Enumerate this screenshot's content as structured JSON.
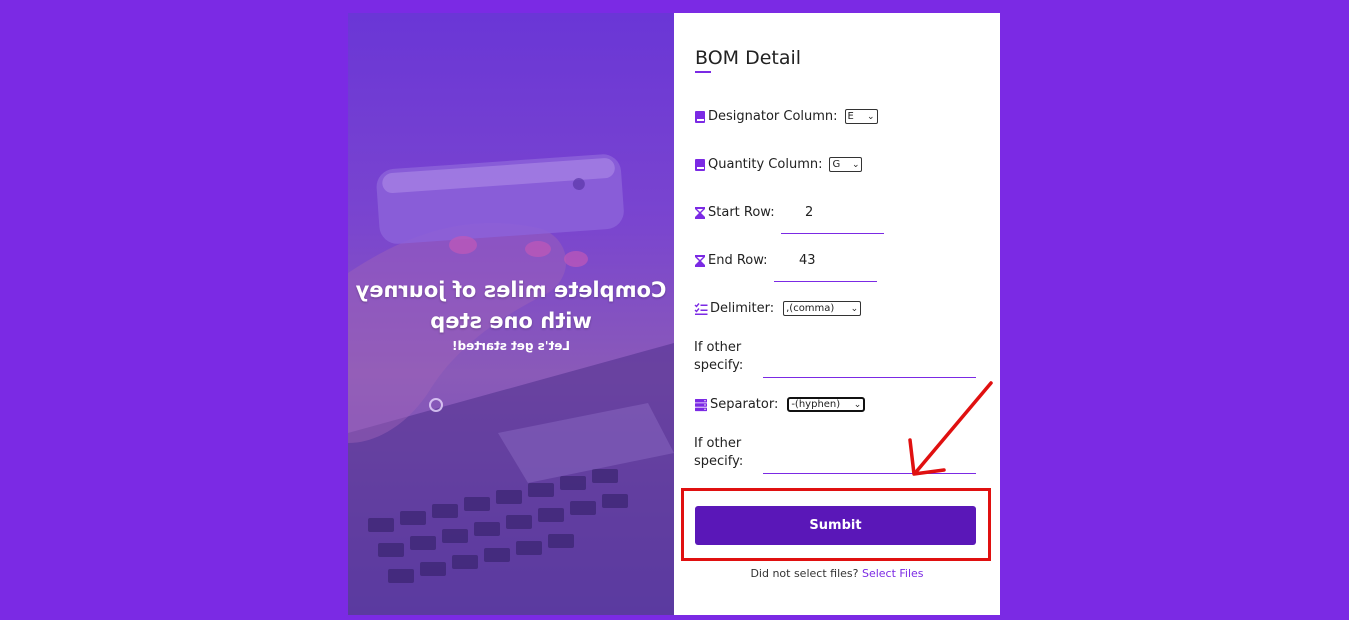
{
  "hero": {
    "title_line1": "Complete miles of journey",
    "title_line2": "with one step",
    "subtitle": "Let's get started!"
  },
  "form": {
    "title": "BOM Detail",
    "designator": {
      "label": "Designator Column:",
      "value": "E"
    },
    "quantity": {
      "label": "Quantity Column:",
      "value": "G"
    },
    "start_row": {
      "label": "Start Row:",
      "value": "2"
    },
    "end_row": {
      "label": "End Row:",
      "value": "43"
    },
    "delimiter": {
      "label": "Delimiter:",
      "value": ",(comma)"
    },
    "delimiter_other": {
      "label_line1": "If other",
      "label_line2": "specify:",
      "value": ""
    },
    "separator": {
      "label": "Separator:",
      "value": "-(hyphen)"
    },
    "separator_other": {
      "label_line1": "If other",
      "label_line2": "specify:",
      "value": ""
    },
    "submit_label": "Sumbit",
    "footer_text": "Did not select files?",
    "footer_link": "Select Files"
  },
  "colors": {
    "background": "#7b2ae4",
    "button": "#5a17b8",
    "highlight": "#e01010"
  }
}
